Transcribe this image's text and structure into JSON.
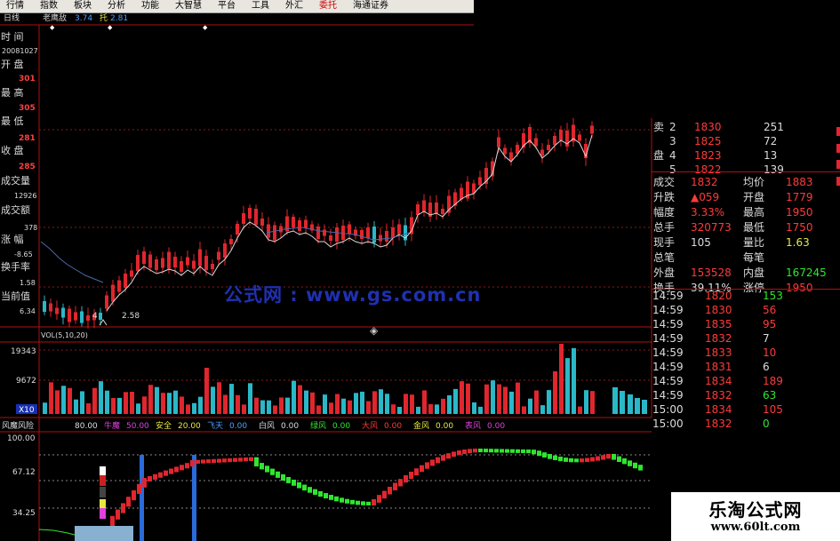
{
  "menu": [
    {
      "label": "行情"
    },
    {
      "label": "指数"
    },
    {
      "label": "板块"
    },
    {
      "label": "分析"
    },
    {
      "label": "功能"
    },
    {
      "label": "大智慧"
    },
    {
      "label": "平台"
    },
    {
      "label": "工具"
    },
    {
      "label": "外汇"
    },
    {
      "label": "委托",
      "active": true
    },
    {
      "label": "海通证券"
    }
  ],
  "toolbar": {
    "period": "日线",
    "name": "老鹰敌",
    "v1": "3.74",
    "fuquan": "托",
    "v2": "2.81"
  },
  "left_panel": {
    "time_label": "时  间",
    "date": "20081027",
    "open_label": "开  盘",
    "open": "301",
    "high_label": "最  高",
    "high": "305",
    "low_label": "最  低",
    "low": "281",
    "close_label": "收  盘",
    "close": "285",
    "volume_label": "成交量",
    "volume": "12926",
    "amount_label": "成交额",
    "amount": "378",
    "change_label": "涨  幅",
    "change": "-8.65",
    "turnover_label": "换手率",
    "turnover": "1.58",
    "current_label": "当前值",
    "current": "6.34"
  },
  "main_chart": {
    "low_label": "2.58",
    "low_left": "4",
    "watermark": "公式网 : www.gs.com.cn"
  },
  "vol_chart": {
    "title": "VOL(5,10,20)",
    "y_labels": [
      "19343",
      "9672"
    ],
    "unit": "X10"
  },
  "indicator": {
    "title": "风魔风险",
    "items": [
      {
        "name": "80.00",
        "color": "#dcdcdc"
      },
      {
        "name": "牛魔",
        "color": "#e040e0"
      },
      {
        "name": "50.00",
        "color": "#e040e0"
      },
      {
        "name": "安全",
        "color": "#e8e840"
      },
      {
        "name": "20.00",
        "color": "#e8e840"
      },
      {
        "name": "飞天",
        "color": "#4aa0ff"
      },
      {
        "name": "0.00",
        "color": "#4aa0ff"
      },
      {
        "name": "白风",
        "color": "#dcdcdc"
      },
      {
        "name": "0.00",
        "color": "#dcdcdc"
      },
      {
        "name": "绿风",
        "color": "#2ee62e"
      },
      {
        "name": "0.00",
        "color": "#2ee62e"
      },
      {
        "name": "大风",
        "color": "#ff3a3a"
      },
      {
        "name": "0.00",
        "color": "#ff3a3a"
      },
      {
        "name": "金风",
        "color": "#e8e840"
      },
      {
        "name": "0.00",
        "color": "#e8e840"
      },
      {
        "name": "表风",
        "color": "#e040e0"
      },
      {
        "name": "0.00",
        "color": "#e040e0"
      }
    ],
    "y_labels": [
      "100.00",
      "67.12",
      "34.25"
    ]
  },
  "order_book": [
    {
      "label": "卖",
      "num": "2",
      "price": "1830",
      "vol": "251"
    },
    {
      "label": "",
      "num": "3",
      "price": "1825",
      "vol": "72"
    },
    {
      "label": "盘",
      "num": "4",
      "price": "1823",
      "vol": "13"
    },
    {
      "label": "",
      "num": "5",
      "price": "1822",
      "vol": "139"
    }
  ],
  "quote": [
    {
      "l1": "成交",
      "v1": "1832",
      "l2": "均价",
      "v2": "1883"
    },
    {
      "l1": "升跌",
      "v1": "▲059",
      "l2": "开盘",
      "v2": "1779"
    },
    {
      "l1": "幅度",
      "v1": "3.33%",
      "l2": "最高",
      "v2": "1950"
    },
    {
      "l1": "总手",
      "v1": "320773",
      "l2": "最低",
      "v2": "1750"
    },
    {
      "l1": "现手",
      "v1": "105",
      "l2": "量比",
      "v2": "1.63"
    },
    {
      "l1": "总笔",
      "v1": "",
      "l2": "每笔",
      "v2": ""
    },
    {
      "l1": "外盘",
      "v1": "153528",
      "l2": "内盘",
      "v2": "167245"
    },
    {
      "l1": "换手",
      "v1": "39.11%",
      "l2": "涨停",
      "v2": "1950"
    }
  ],
  "ticks": [
    {
      "time": "14:59",
      "price": "1820",
      "vol": "153",
      "vc": "g"
    },
    {
      "time": "14:59",
      "price": "1830",
      "vol": "56",
      "vc": "r"
    },
    {
      "time": "14:59",
      "price": "1835",
      "vol": "95",
      "vc": "r"
    },
    {
      "time": "14:59",
      "price": "1832",
      "vol": "7",
      "vc": "w"
    },
    {
      "time": "14:59",
      "price": "1833",
      "vol": "10",
      "vc": "r"
    },
    {
      "time": "14:59",
      "price": "1831",
      "vol": "6",
      "vc": "w"
    },
    {
      "time": "14:59",
      "price": "1834",
      "vol": "189",
      "vc": "r"
    },
    {
      "time": "14:59",
      "price": "1832",
      "vol": "63",
      "vc": "g"
    },
    {
      "time": "15:00",
      "price": "1834",
      "vol": "105",
      "vc": "r"
    },
    {
      "time": "15:00",
      "price": "1832",
      "vol": "0",
      "vc": "g"
    }
  ],
  "brand": {
    "cn": "乐淘公式网",
    "url": "www.60lt.com"
  },
  "colors": {
    "up": "#e0262e",
    "down": "#2ab8c8",
    "ma": "#d8d8d8",
    "grid": "#8b1a1a",
    "frame": "#b01010"
  }
}
